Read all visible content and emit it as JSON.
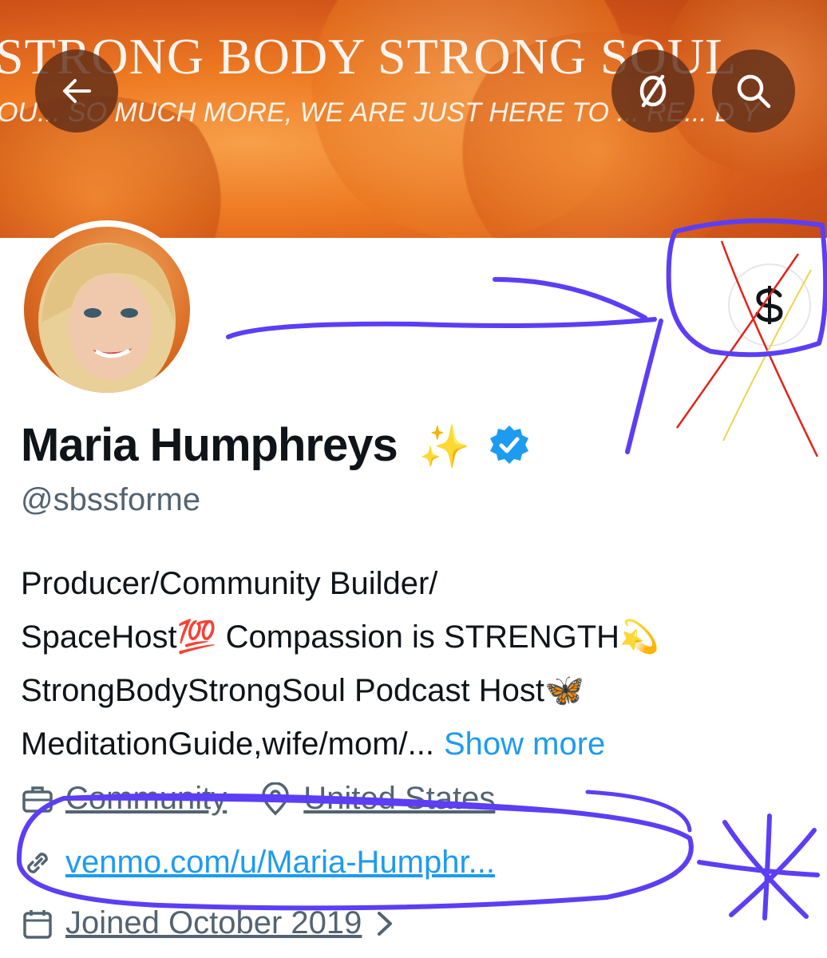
{
  "banner": {
    "title": "STRONG BODY STRONG SOUL",
    "subtitle": "OU... SO MUCH MORE, WE ARE JUST HERE TO ... RE... D Y"
  },
  "profile": {
    "name": "Maria Humphreys",
    "name_emoji": "✨",
    "handle": "@sbssforme",
    "verified_color": "#1d9bf0",
    "bio_lines": [
      "Producer/Community Builder/",
      "SpaceHost💯 Compassion is STRENGTH💫",
      "StrongBodyStrongSoul Podcast Host🦋",
      "MeditationGuide,wife/mom/..."
    ],
    "show_more": "Show more",
    "category": "Community",
    "location": "United States",
    "website": "venmo.com/u/Maria-Humphr...",
    "joined": "Joined October 2019"
  },
  "icons": {
    "back": "back-arrow-icon",
    "dollar": "dollar-icon",
    "search": "search-icon",
    "tip": "tip-jar-icon",
    "briefcase": "briefcase-icon",
    "location": "location-pin-icon",
    "link": "link-icon",
    "calendar": "calendar-icon"
  },
  "colors": {
    "annotation_purple": "#5b3ef5",
    "annotation_red": "#e2231a",
    "annotation_yellow": "#f1d34a",
    "link_blue": "#1d9bf0"
  }
}
